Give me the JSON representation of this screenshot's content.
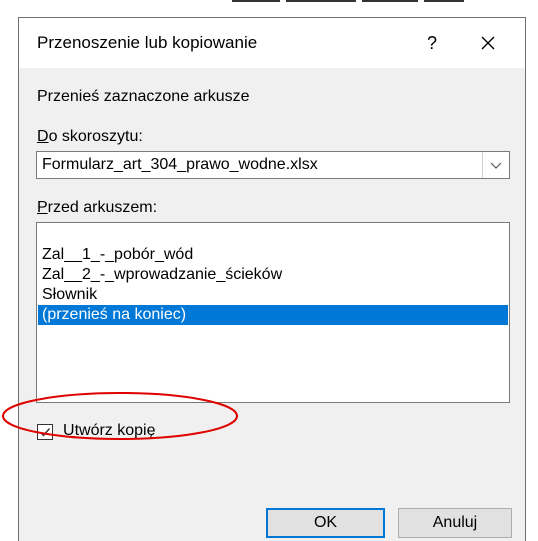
{
  "dialog": {
    "title": "Przenoszenie lub kopiowanie",
    "help_label": "?",
    "header": "Przenieś zaznaczone arkusze"
  },
  "workbook": {
    "label_accel": "D",
    "label_rest": "o skoroszytu:",
    "selected": "Formularz_art_304_prawo_wodne.xlsx"
  },
  "sheets": {
    "label_accel": "P",
    "label_rest": "rzed arkuszem:",
    "items": [
      {
        "label": "Zal__1_-_pobór_wód",
        "selected": false
      },
      {
        "label": "Zal__2_-_wprowadzanie_ścieków",
        "selected": false
      },
      {
        "label": "Słownik",
        "selected": false
      },
      {
        "label": "(przenieś na koniec)",
        "selected": true
      }
    ]
  },
  "copy_checkbox": {
    "label_accel": "U",
    "label_rest": "twórz kopię",
    "checked": true
  },
  "buttons": {
    "ok": "OK",
    "cancel": "Anuluj"
  },
  "colors": {
    "selection": "#0078d7",
    "annotation": "#e00000",
    "dialog_bg": "#f0f0f0"
  },
  "icons": {
    "close": "close-icon",
    "dropdown": "chevron-down-icon",
    "check": "check-icon"
  }
}
